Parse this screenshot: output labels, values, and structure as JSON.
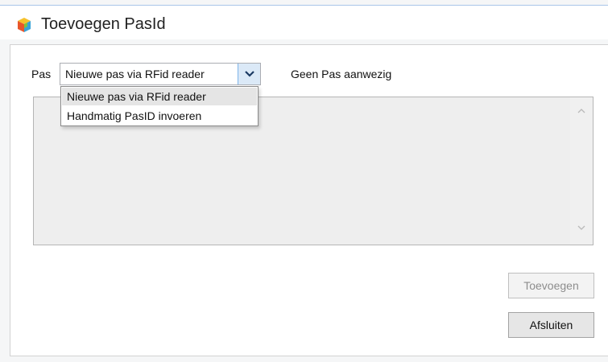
{
  "window": {
    "title": "Toevoegen PasId",
    "icon": "app-cube-icon"
  },
  "form": {
    "pas_label": "Pas",
    "combo_value": "Nieuwe pas via RFid reader",
    "status_text": "Geen Pas aanwezig",
    "dropdown_options": [
      {
        "label": "Nieuwe pas via RFid reader",
        "selected": true
      },
      {
        "label": "Handmatig PasID invoeren",
        "selected": false
      }
    ]
  },
  "buttons": {
    "add_label": "Toevoegen",
    "add_enabled": false,
    "close_label": "Afsluiten",
    "close_enabled": true
  },
  "colors": {
    "accent": "#7eb4ea",
    "combo_button_bg": "#dbe9f7",
    "textarea_bg": "#eeeeee"
  }
}
